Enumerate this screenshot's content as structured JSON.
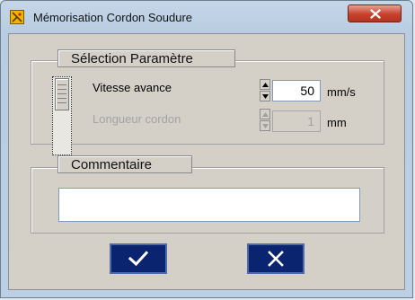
{
  "window": {
    "title": "Mémorisation Cordon Soudure",
    "icon": "app-yellow-icon",
    "close_icon": "close-icon"
  },
  "selection_group": {
    "title": "Sélection Paramètre",
    "slider": {
      "position": "top"
    },
    "params": [
      {
        "label": "Vitesse avance",
        "value": "50",
        "unit": "mm/s",
        "enabled": true
      },
      {
        "label": "Longueur cordon",
        "value": "1",
        "unit": "mm",
        "enabled": false
      }
    ]
  },
  "comment_group": {
    "title": "Commentaire",
    "value": ""
  },
  "buttons": {
    "ok_icon": "checkmark-icon",
    "cancel_icon": "cross-icon"
  },
  "colors": {
    "title_bar": "#c5d6e8",
    "close_button": "#c7412c",
    "dialog_bg": "#d4d0c8",
    "action_button": "#0a2470"
  }
}
